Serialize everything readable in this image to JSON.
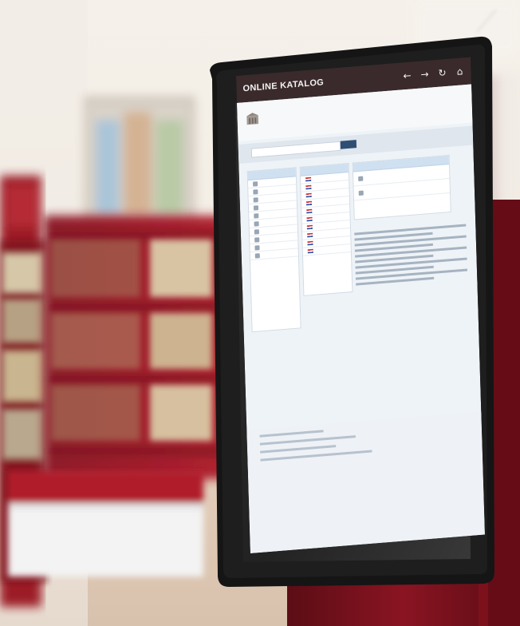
{
  "kiosk": {
    "title": "ONLINE KATALOG",
    "icons": {
      "back": "←",
      "forward": "→",
      "reload": "↻",
      "home": "⌂"
    }
  },
  "colors": {
    "kiosk_bar": "#3a2a2b",
    "page_bg": "#eef3f7",
    "accent_blue": "#2f4e73",
    "shelf_red": "#a31f2c"
  }
}
